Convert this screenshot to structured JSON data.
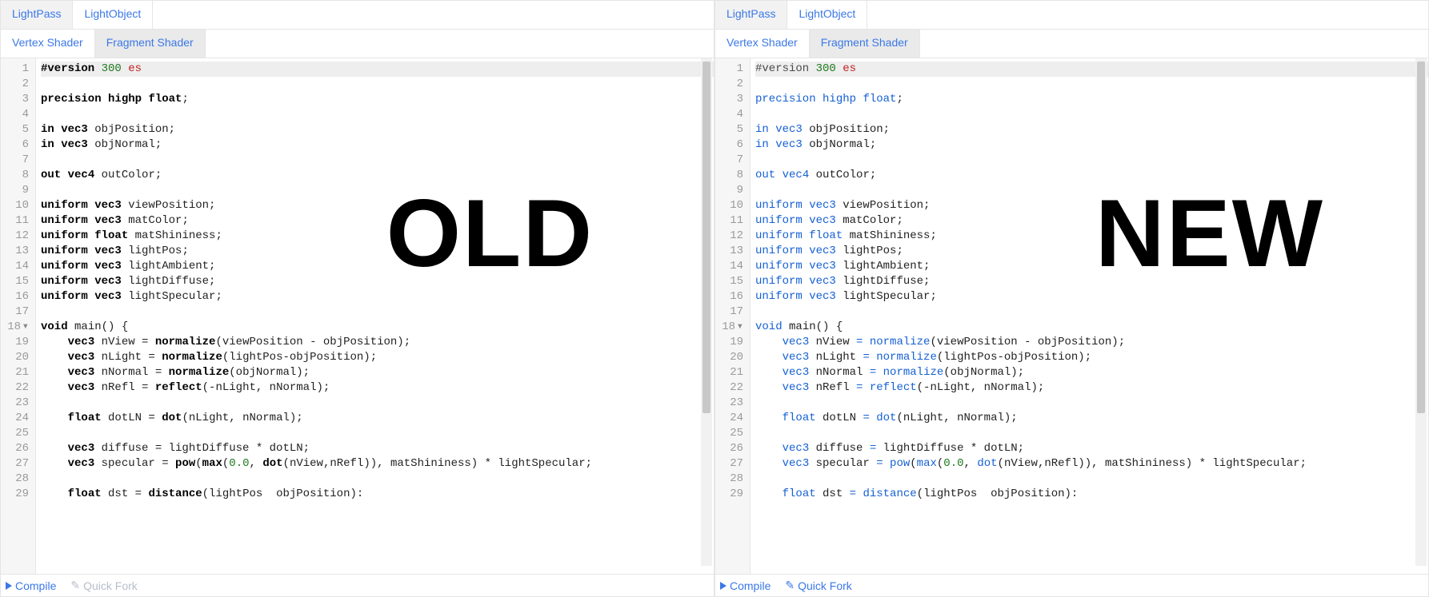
{
  "watermarks": {
    "old": "OLD",
    "new": "NEW"
  },
  "file_tabs": {
    "lightpass": "LightPass",
    "lightobject": "LightObject"
  },
  "shader_tabs": {
    "vertex": "Vertex Shader",
    "fragment": "Fragment Shader"
  },
  "bottom": {
    "compile": "Compile",
    "quickfork": "Quick Fork"
  },
  "gutter_lines": [
    "1",
    "2",
    "3",
    "4",
    "5",
    "6",
    "7",
    "8",
    "9",
    "10",
    "11",
    "12",
    "13",
    "14",
    "15",
    "16",
    "17",
    "18",
    "19",
    "20",
    "21",
    "22",
    "23",
    "24",
    "25",
    "26",
    "27",
    "28",
    "29"
  ],
  "code": {
    "l1_pp": "#version",
    "l1_num": "300",
    "l1_err": "es",
    "l3_kw": "precision",
    "l3_t": "highp float",
    "semicolon": ";",
    "in": "in",
    "out": "out",
    "uniform": "uniform",
    "vec3": "vec3",
    "vec4": "vec4",
    "float": "float",
    "void": "void",
    "objPosition": " objPosition;",
    "objNormal": " objNormal;",
    "outColor": " outColor;",
    "viewPosition": " viewPosition;",
    "matColor": " matColor;",
    "matShininess": " matShininess;",
    "lightPos": " lightPos;",
    "lightAmbient": " lightAmbient;",
    "lightDiffuse": " lightDiffuse;",
    "lightSpecular": " lightSpecular;",
    "main_sig": " main() {",
    "l19a": "    ",
    "l19b": " nView ",
    "eq": "=",
    "normalize": "normalize",
    "l19c": "(viewPosition - objPosition);",
    "l20b": " nLight ",
    "l20c": "(lightPos-objPosition);",
    "l21b": " nNormal ",
    "l21c": "(objNormal);",
    "l22b": " nRefl ",
    "reflect": "reflect",
    "l22c": "(-nLight, nNormal);",
    "l24b": " dotLN ",
    "dot": "dot",
    "l24c": "(nLight, nNormal);",
    "l26b": " diffuse ",
    "l26c": " lightDiffuse * dotLN;",
    "l27b": " specular ",
    "pow": "pow",
    "max": "max",
    "zero": "0.0",
    "l27c": "(",
    "l27d": "(",
    "l27e": ", ",
    "l27f": "(nView,nRefl)), matShininess) * lightSpecular;",
    "l29b": " dst ",
    "distance": "distance",
    "l29c": "(lightPos  objPosition):"
  }
}
